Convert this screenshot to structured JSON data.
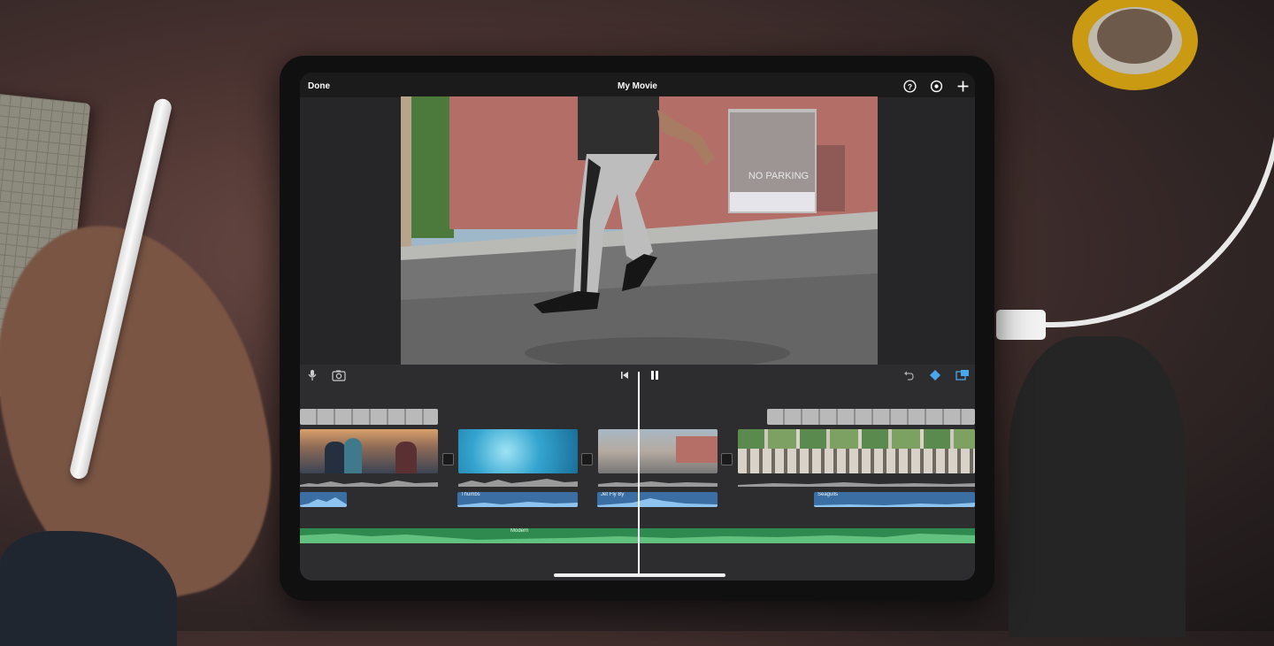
{
  "app": {
    "done_label": "Done",
    "title": "My Movie"
  },
  "toolbar": {
    "icons": [
      "help-icon",
      "settings-icon",
      "add-icon"
    ]
  },
  "timeline_toolbar": {
    "left_icons": [
      "microphone-icon",
      "camera-icon"
    ],
    "center_icons": [
      "skip-to-start-icon",
      "pause-icon"
    ],
    "right_icons": [
      "undo-icon",
      "keyframe-icon",
      "picture-in-picture-icon"
    ]
  },
  "viewer": {
    "sign_text": "NO PARKING"
  },
  "audio_clips": [
    {
      "label": ""
    },
    {
      "label": "Thumbs"
    },
    {
      "label": "Jet Fly By"
    },
    {
      "label": "Seagulls"
    }
  ],
  "music_track": {
    "label": "Modern"
  },
  "colors": {
    "audio_clip": "#3b6fa3",
    "music_track": "#2e8a4e",
    "accent": "#4aa8e8"
  }
}
